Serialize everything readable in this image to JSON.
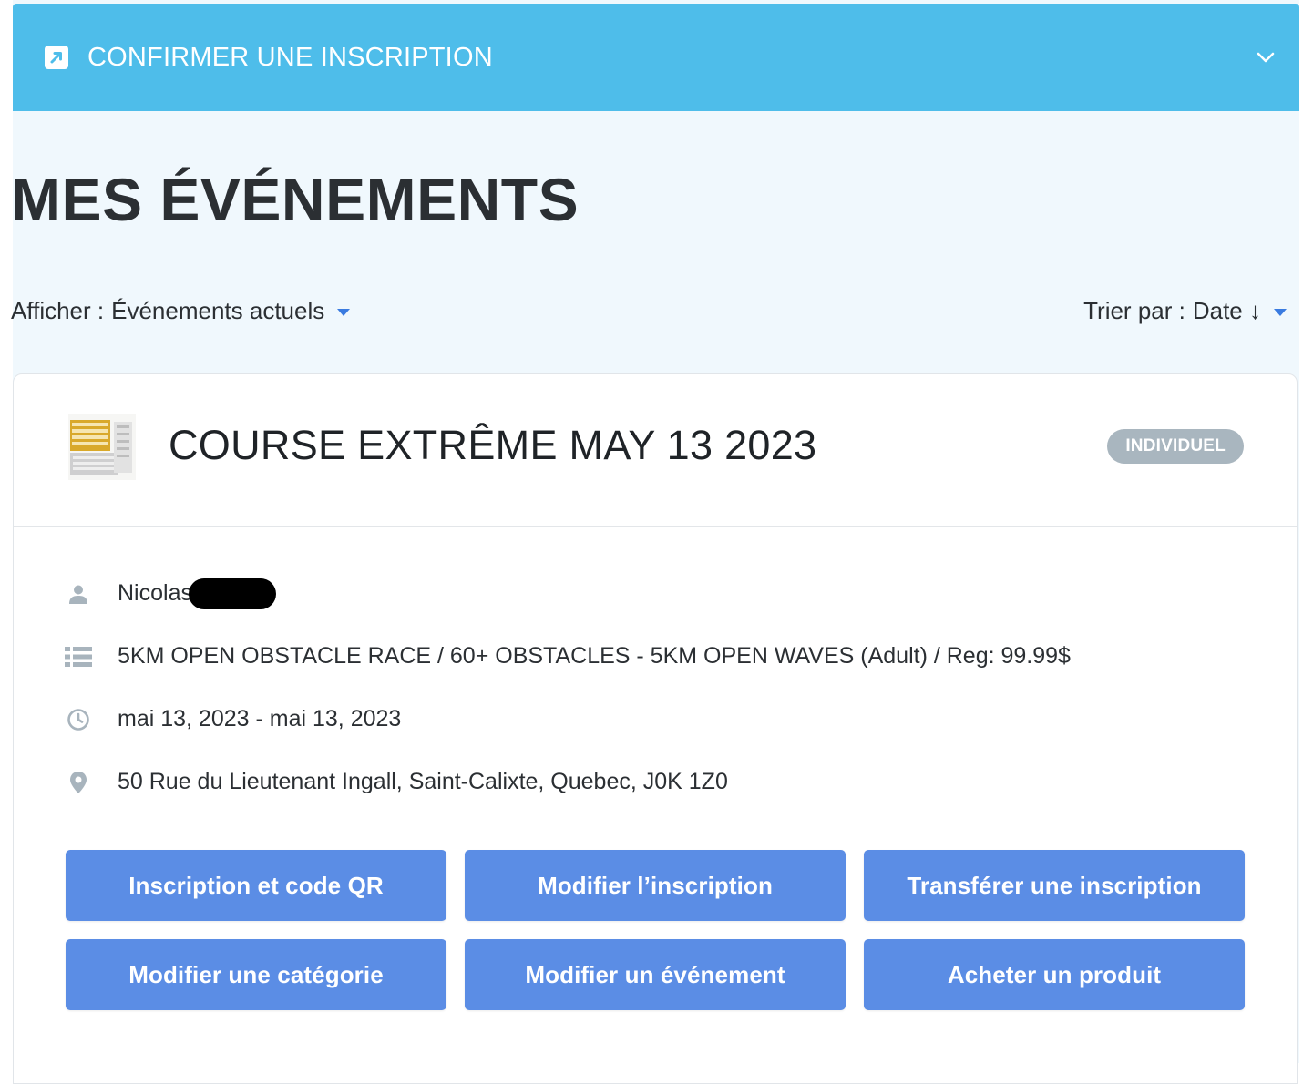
{
  "banner": {
    "label": "CONFIRMER UNE INSCRIPTION",
    "icon": "external-link-icon",
    "chevron": "chevron-down-icon",
    "color": "#4ebdea"
  },
  "page": {
    "title": "MES ÉVÉNEMENTS"
  },
  "filters": {
    "show_label": "Afficher :",
    "show_value": "Événements actuels",
    "sort_label": "Trier par :",
    "sort_value": "Date ↓"
  },
  "event": {
    "title": "COURSE EXTRÊME MAY 13 2023",
    "badge": "INDIVIDUEL",
    "logo_text": "COURSE EXTRÊME",
    "participant": "Nicolas",
    "category": "5KM OPEN OBSTACLE RACE / 60+ OBSTACLES - 5KM OPEN WAVES (Adult) / Reg: 99.99$",
    "dates": "mai 13, 2023 - mai 13, 2023",
    "address": "50 Rue du Lieutenant Ingall, Saint-Calixte, Quebec, J0K 1Z0"
  },
  "actions": {
    "registration_qr": "Inscription et code QR",
    "edit_registration": "Modifier l’inscription",
    "transfer_registration": "Transférer une inscription",
    "edit_category": "Modifier une catégorie",
    "edit_event": "Modifier un événement",
    "buy_product": "Acheter un produit"
  },
  "colors": {
    "button": "#5b8de5",
    "badge": "#a9b6bf",
    "page_background": "#f0f8fd",
    "caret": "#3a7be0"
  }
}
